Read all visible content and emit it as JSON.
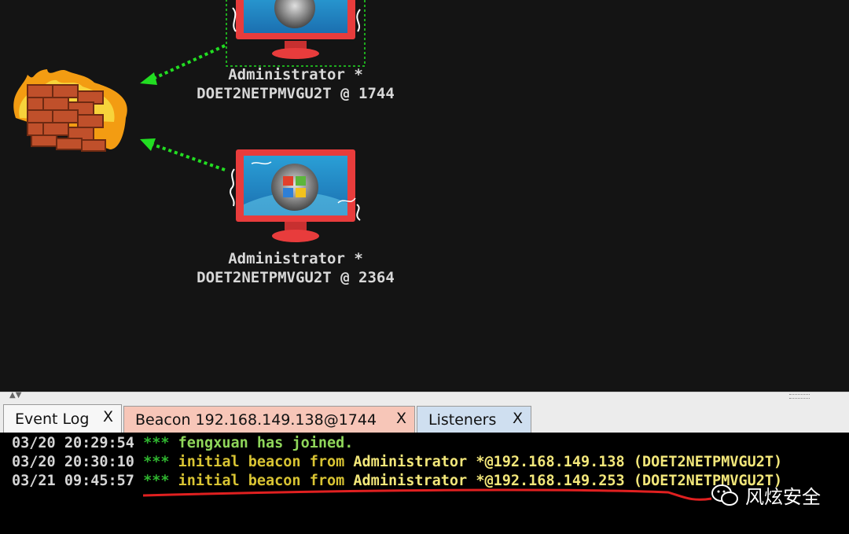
{
  "graph": {
    "nodes": [
      {
        "user": "Administrator *",
        "host": "DOET2NETPMVGU2T @ 1744",
        "selected": true
      },
      {
        "user": "Administrator *",
        "host": "DOET2NETPMVGU2T @ 2364",
        "selected": false
      }
    ]
  },
  "tabs": [
    {
      "label": "Event Log",
      "close": "X",
      "active": true,
      "color": "#f7f7f7"
    },
    {
      "label": "Beacon 192.168.149.138@1744",
      "close": "X",
      "active": false,
      "color": "#f7c6b8"
    },
    {
      "label": "Listeners",
      "close": "X",
      "active": false,
      "color": "#cfdff0"
    }
  ],
  "log": [
    {
      "ts": "03/20 20:29:54",
      "stars": "***",
      "user": "fengxuan",
      "msg": " has joined."
    },
    {
      "ts": "03/20 20:30:10",
      "stars": "***",
      "pre": "initial beacon from ",
      "who": "Administrator *@192.168.149.138 (DOET2NETPMVGU2T)"
    },
    {
      "ts": "03/21 09:45:57",
      "stars": "***",
      "pre": "initial beacon from ",
      "who": "Administrator *@192.168.149.253 (DOET2NETPMVGU2T)"
    }
  ],
  "watermark": {
    "text": "风炫安全",
    "icon": "wechat-icon"
  },
  "colors": {
    "highlight_underline": "#e02020",
    "arrow": "#22dd22",
    "selection": "#22dd22"
  }
}
